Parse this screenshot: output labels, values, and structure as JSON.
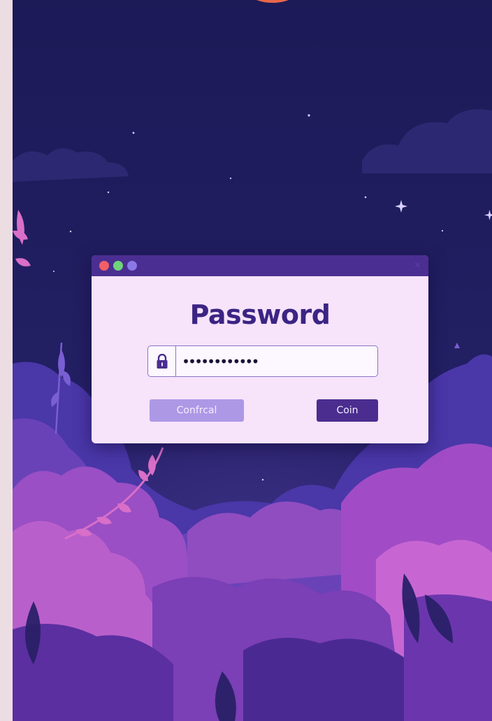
{
  "dialog": {
    "title": "Password",
    "password": {
      "value": "••••••••••••",
      "icon": "lock-icon"
    },
    "buttons": {
      "confirm_label": "Confrcal",
      "coin_label": "Coin"
    },
    "titlebar": {
      "close_glyph": "×"
    }
  },
  "colors": {
    "sky": "#1f1d5c",
    "titlebar": "#4b2e92",
    "dialog_bg": "#f7e3fa",
    "title_text": "#3b2483",
    "confirm_button": "#ad98e6",
    "coin_button": "#4a2d8f",
    "traffic_red": "#f35f66",
    "traffic_green": "#6fd47a",
    "traffic_blue": "#8a79e6"
  }
}
